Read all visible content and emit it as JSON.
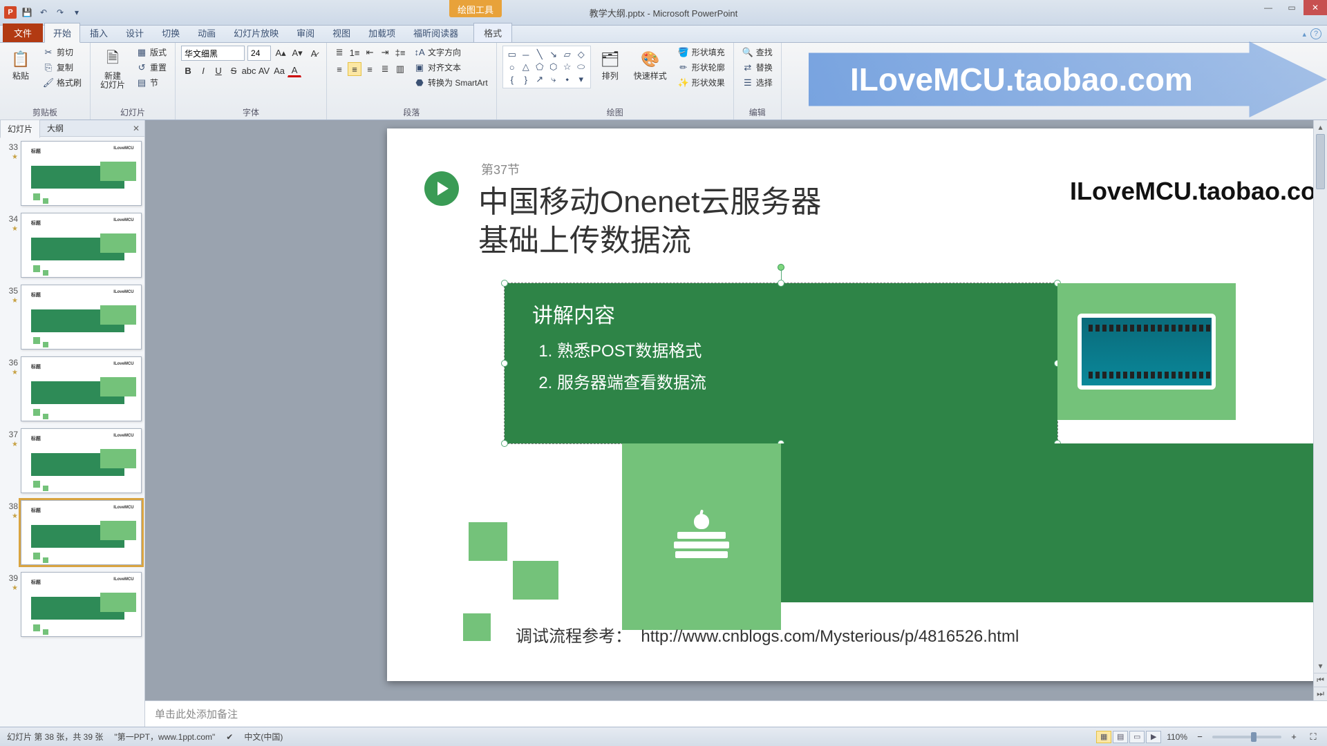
{
  "app": {
    "name": "Microsoft PowerPoint",
    "document": "教学大纲.pptx",
    "full_title": "教学大纲.pptx - Microsoft PowerPoint"
  },
  "context_tool": {
    "group": "绘图工具",
    "tab": "格式"
  },
  "tabs": {
    "file": "文件",
    "items": [
      "开始",
      "插入",
      "设计",
      "切换",
      "动画",
      "幻灯片放映",
      "审阅",
      "视图",
      "加载项",
      "福昕阅读器"
    ],
    "active": "开始"
  },
  "ribbon": {
    "clipboard": {
      "label": "剪贴板",
      "paste": "粘贴",
      "cut": "剪切",
      "copy": "复制",
      "format_painter": "格式刷"
    },
    "slides": {
      "label": "幻灯片",
      "new_slide": "新建\n幻灯片",
      "layout": "版式",
      "reset": "重置",
      "section": "节"
    },
    "font": {
      "label": "字体",
      "name": "华文细黑",
      "size": "24"
    },
    "paragraph": {
      "label": "段落",
      "text_direction": "文字方向",
      "align_text": "对齐文本",
      "smartart": "转换为 SmartArt"
    },
    "drawing": {
      "label": "绘图",
      "arrange": "排列",
      "quick_styles": "快速样式",
      "shape_fill": "形状填充",
      "shape_outline": "形状轮廓",
      "shape_effects": "形状效果"
    },
    "editing": {
      "label": "编辑",
      "find": "查找",
      "replace": "替换",
      "select": "选择"
    }
  },
  "banner_text": "ILoveMCU.taobao.com",
  "panel": {
    "tab_slides": "幻灯片",
    "tab_outline": "大纲"
  },
  "thumbs": [
    {
      "num": "33"
    },
    {
      "num": "34"
    },
    {
      "num": "35"
    },
    {
      "num": "36"
    },
    {
      "num": "37"
    },
    {
      "num": "38",
      "selected": true
    },
    {
      "num": "39"
    }
  ],
  "slide": {
    "section": "第37节",
    "title_line1": "中国移动Onenet云服务器",
    "title_line2": "基础上传数据流",
    "brand": "ILoveMCU.taobao.com",
    "content_title": "讲解内容",
    "bullet1": "熟悉POST数据格式",
    "bullet2": "服务器端查看数据流",
    "ref_label": "调试流程参考：",
    "ref_url": "http://www.cnblogs.com/Mysterious/p/4816526.html"
  },
  "notes_placeholder": "单击此处添加备注",
  "status": {
    "slide_counter": "幻灯片 第 38 张，共 39 张",
    "theme": "\"第一PPT，www.1ppt.com\"",
    "language": "中文(中国)",
    "zoom": "110%"
  }
}
